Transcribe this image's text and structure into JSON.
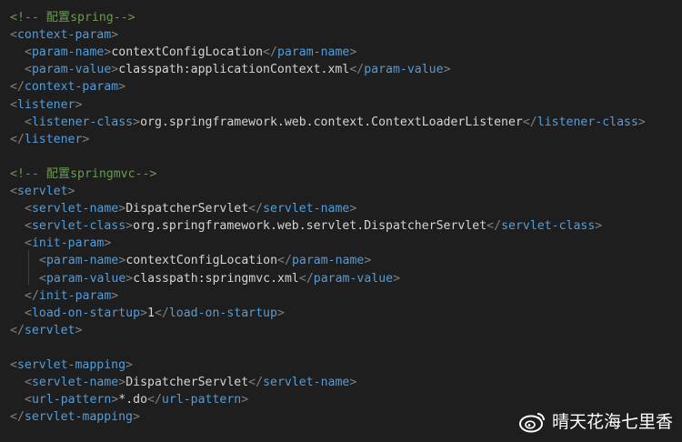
{
  "lines": [
    {
      "type": "comment",
      "indent": 0,
      "text": "<!-- 配置spring-->"
    },
    {
      "type": "open",
      "indent": 0,
      "tag": "context-param"
    },
    {
      "type": "elem",
      "indent": 1,
      "tag": "param-name",
      "value": "contextConfigLocation"
    },
    {
      "type": "elem",
      "indent": 1,
      "tag": "param-value",
      "value": "classpath:applicationContext.xml"
    },
    {
      "type": "close",
      "indent": 0,
      "tag": "context-param"
    },
    {
      "type": "open",
      "indent": 0,
      "tag": "listener"
    },
    {
      "type": "elem",
      "indent": 1,
      "tag": "listener-class",
      "value": "org.springframework.web.context.ContextLoaderListener"
    },
    {
      "type": "close",
      "indent": 0,
      "tag": "listener"
    },
    {
      "type": "blank",
      "indent": 0
    },
    {
      "type": "comment",
      "indent": 0,
      "text": "<!-- 配置springmvc-->"
    },
    {
      "type": "open",
      "indent": 0,
      "tag": "servlet"
    },
    {
      "type": "elem",
      "indent": 1,
      "tag": "servlet-name",
      "value": "DispatcherServlet"
    },
    {
      "type": "elem",
      "indent": 1,
      "tag": "servlet-class",
      "value": "org.springframework.web.servlet.DispatcherServlet"
    },
    {
      "type": "open",
      "indent": 1,
      "tag": "init-param"
    },
    {
      "type": "elem",
      "indent": 2,
      "tag": "param-name",
      "value": "contextConfigLocation"
    },
    {
      "type": "elem",
      "indent": 2,
      "tag": "param-value",
      "value": "classpath:springmvc.xml"
    },
    {
      "type": "close",
      "indent": 1,
      "tag": "init-param"
    },
    {
      "type": "elem",
      "indent": 1,
      "tag": "load-on-startup",
      "value": "1"
    },
    {
      "type": "close",
      "indent": 0,
      "tag": "servlet"
    },
    {
      "type": "blank",
      "indent": 0
    },
    {
      "type": "open",
      "indent": 0,
      "tag": "servlet-mapping"
    },
    {
      "type": "elem",
      "indent": 1,
      "tag": "servlet-name",
      "value": "DispatcherServlet"
    },
    {
      "type": "elem",
      "indent": 1,
      "tag": "url-pattern",
      "value": "*.do"
    },
    {
      "type": "close",
      "indent": 0,
      "tag": "servlet-mapping"
    }
  ],
  "watermark": {
    "text": "晴天花海七里香",
    "icon": "weibo-icon"
  },
  "colors": {
    "background": "#1e1e1e",
    "comment": "#6a9955",
    "tag": "#569cd6",
    "bracket": "#808080",
    "text": "#d4d4d4"
  }
}
